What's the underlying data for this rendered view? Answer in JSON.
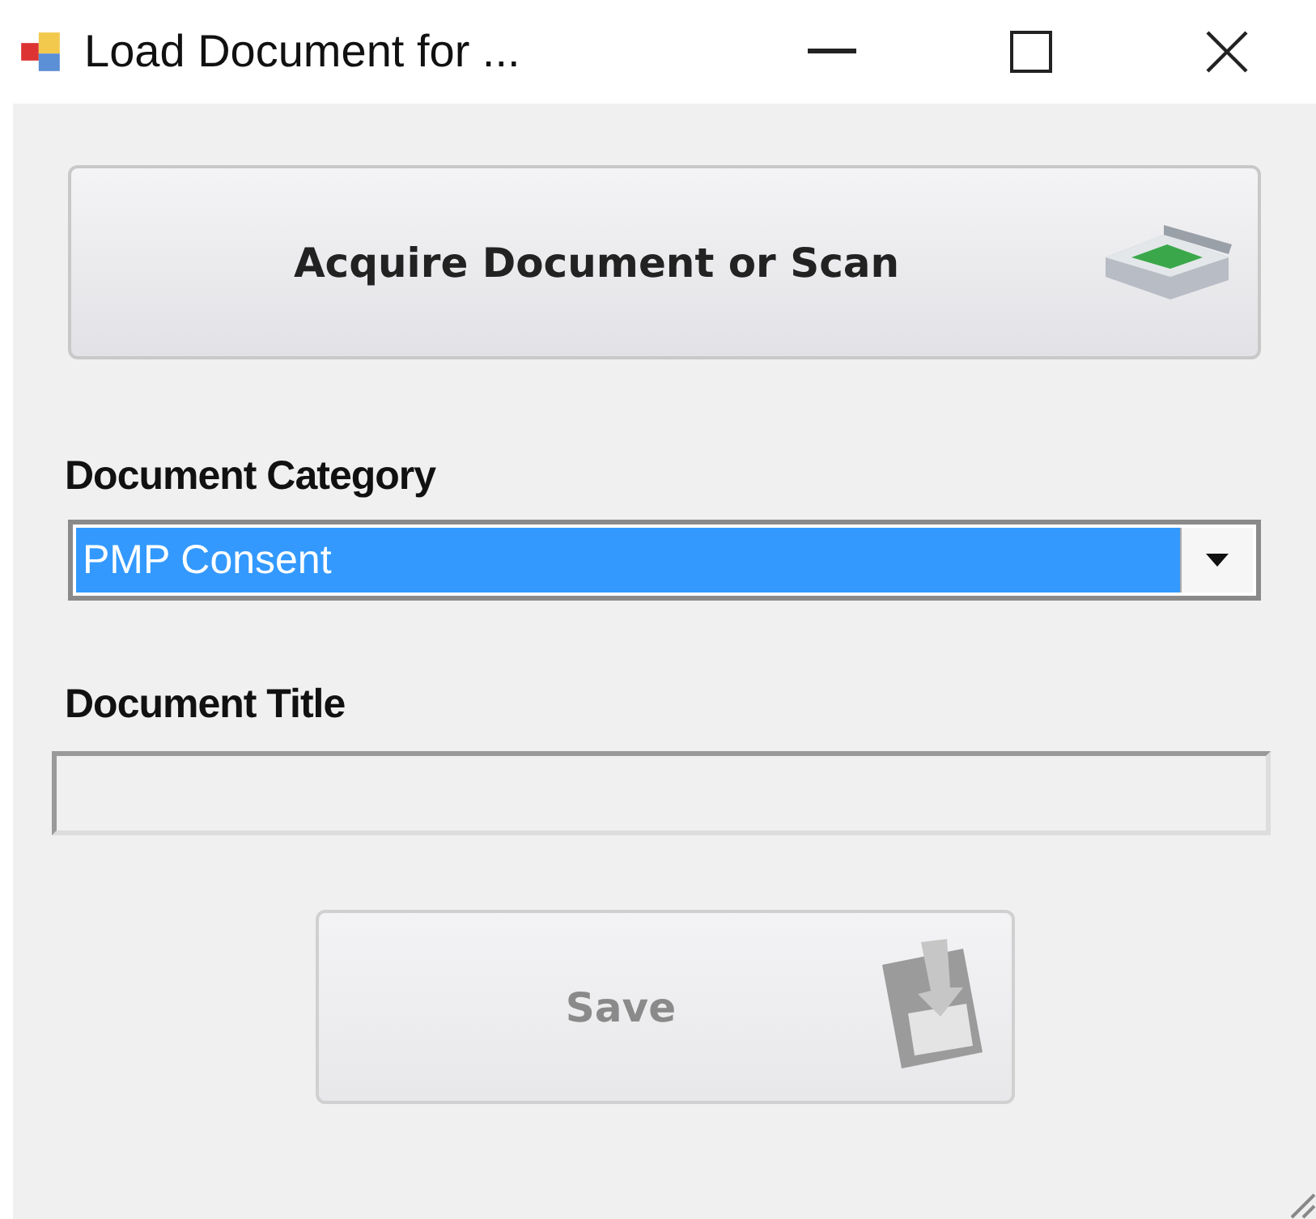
{
  "window": {
    "title": "Load Document for ..."
  },
  "acquire_button": {
    "label": "Acquire Document or Scan"
  },
  "category": {
    "label": "Document Category",
    "value": "PMP Consent",
    "focused": true
  },
  "title_field": {
    "label": "Document Title"
  },
  "save_button": {
    "label": "Save",
    "disabled": true
  }
}
